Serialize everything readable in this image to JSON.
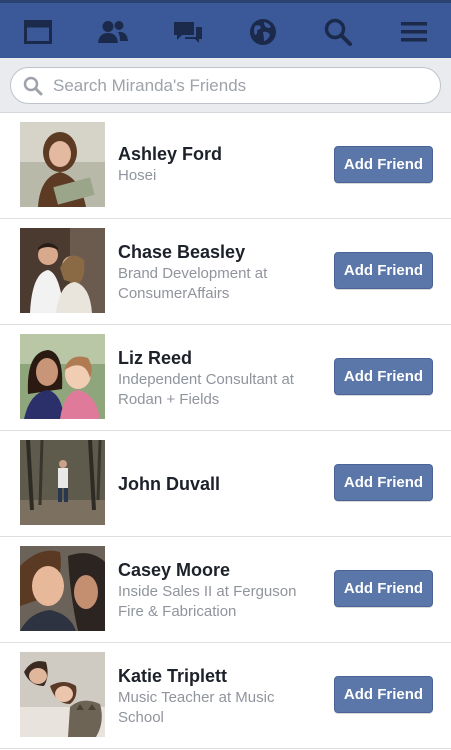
{
  "colors": {
    "nav_bg": "#3b5998",
    "button_bg": "#5b76a8",
    "name_text": "#1d2129",
    "subtitle_text": "#90949c"
  },
  "nav": {
    "icons": [
      "feed-icon",
      "friends-icon",
      "messages-icon",
      "notifications-globe-icon",
      "search-icon",
      "menu-icon"
    ]
  },
  "search": {
    "placeholder": "Search Miranda's Friends",
    "value": ""
  },
  "friends": [
    {
      "name": "Ashley Ford",
      "subtitle": [
        "Hosei"
      ],
      "button": "Add Friend"
    },
    {
      "name": "Chase Beasley",
      "subtitle": [
        "Brand Development at",
        "ConsumerAffairs"
      ],
      "button": "Add Friend"
    },
    {
      "name": "Liz Reed",
      "subtitle": [
        "Independent Consultant at",
        "Rodan + Fields"
      ],
      "button": "Add Friend"
    },
    {
      "name": "John Duvall",
      "subtitle": [],
      "button": "Add Friend"
    },
    {
      "name": "Casey Moore",
      "subtitle": [
        "Inside Sales II at Ferguson",
        "Fire & Fabrication"
      ],
      "button": "Add Friend"
    },
    {
      "name": "Katie Triplett",
      "subtitle": [
        "Music Teacher at Music",
        "School"
      ],
      "button": "Add Friend"
    }
  ]
}
